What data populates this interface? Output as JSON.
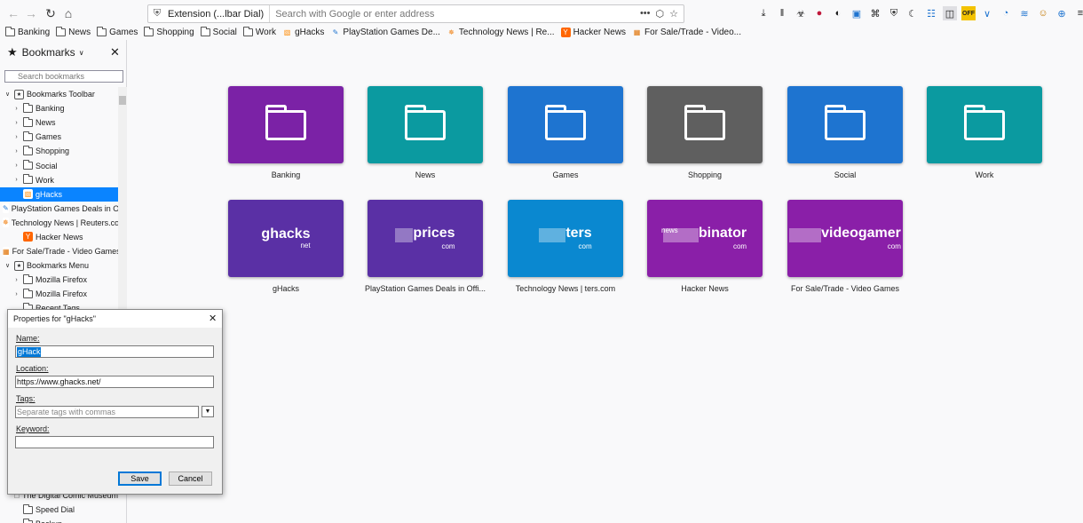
{
  "toolbar": {
    "url_identity": "Extension (...lbar Dial)",
    "url_placeholder": "Search with Google or enter address",
    "off_badge": "OFF"
  },
  "bookmarks_toolbar": [
    {
      "label": "Banking",
      "icon": "folder"
    },
    {
      "label": "News",
      "icon": "folder"
    },
    {
      "label": "Games",
      "icon": "folder"
    },
    {
      "label": "Shopping",
      "icon": "folder"
    },
    {
      "label": "Social",
      "icon": "folder"
    },
    {
      "label": "Work",
      "icon": "folder"
    },
    {
      "label": "gHacks",
      "icon": "ghacks-favicon"
    },
    {
      "label": "PlayStation Games De...",
      "icon": "playstation-favicon"
    },
    {
      "label": "Technology News | Re...",
      "icon": "reuters-favicon"
    },
    {
      "label": "Hacker News",
      "icon": "ycombinator-favicon"
    },
    {
      "label": "For Sale/Trade - Video...",
      "icon": "videogamer-favicon"
    }
  ],
  "sidebar": {
    "title": "Bookmarks",
    "search_placeholder": "Search bookmarks",
    "tree": [
      {
        "label": "Bookmarks Toolbar",
        "level": 0,
        "twisty": "open",
        "icon": "toolbar"
      },
      {
        "label": "Banking",
        "level": 1,
        "twisty": "closed",
        "icon": "folder"
      },
      {
        "label": "News",
        "level": 1,
        "twisty": "closed",
        "icon": "folder"
      },
      {
        "label": "Games",
        "level": 1,
        "twisty": "closed",
        "icon": "folder"
      },
      {
        "label": "Shopping",
        "level": 1,
        "twisty": "closed",
        "icon": "folder"
      },
      {
        "label": "Social",
        "level": 1,
        "twisty": "closed",
        "icon": "folder"
      },
      {
        "label": "Work",
        "level": 1,
        "twisty": "closed",
        "icon": "folder"
      },
      {
        "label": "gHacks",
        "level": 1,
        "twisty": "none",
        "icon": "ghacks",
        "selected": true
      },
      {
        "label": "PlayStation Games Deals in Offi...",
        "level": 1,
        "twisty": "none",
        "icon": "playstation"
      },
      {
        "label": "Technology News | Reuters.com",
        "level": 1,
        "twisty": "none",
        "icon": "reuters"
      },
      {
        "label": "Hacker News",
        "level": 1,
        "twisty": "none",
        "icon": "ycombinator"
      },
      {
        "label": "For Sale/Trade - Video Games",
        "level": 1,
        "twisty": "none",
        "icon": "videogamer"
      },
      {
        "label": "Bookmarks Menu",
        "level": 0,
        "twisty": "open",
        "icon": "menu"
      },
      {
        "label": "Mozilla Firefox",
        "level": 1,
        "twisty": "closed",
        "icon": "folder"
      },
      {
        "label": "Mozilla Firefox",
        "level": 1,
        "twisty": "closed",
        "icon": "folder"
      },
      {
        "label": "Recent Tags",
        "level": 1,
        "twisty": "none",
        "icon": "folder"
      }
    ],
    "tree_bottom": [
      {
        "label": "The Digital Comic Museum",
        "icon": "page"
      },
      {
        "label": "Speed Dial",
        "icon": "folder"
      },
      {
        "label": "Backup",
        "icon": "folder"
      }
    ]
  },
  "speed_dial": {
    "row1": [
      {
        "label": "Banking",
        "color": "#7b22a6"
      },
      {
        "label": "News",
        "color": "#0b9aa0"
      },
      {
        "label": "Games",
        "color": "#1e74d0"
      },
      {
        "label": "Shopping",
        "color": "#5f5f5f"
      },
      {
        "label": "Social",
        "color": "#1e74d0"
      },
      {
        "label": "Work",
        "color": "#0b9aa0"
      }
    ],
    "row2": [
      {
        "label": "gHacks",
        "color": "#5a30a5",
        "logo_main": "ghacks",
        "logo_sub": "net"
      },
      {
        "label": "PlayStation Games Deals in Offi...",
        "color": "#5a30a5",
        "logo_main": "prices",
        "logo_sub": "com"
      },
      {
        "label": "Technology News | ters.com",
        "color": "#0a88d0",
        "logo_main": "ters",
        "logo_sub": "com"
      },
      {
        "label": "Hacker News",
        "color": "#8a1fa8",
        "logo_top": "news",
        "logo_main": "binator",
        "logo_sub": "com"
      },
      {
        "label": "For Sale/Trade - Video Games",
        "color": "#8a1fa8",
        "logo_main": "videogamer",
        "logo_sub": "com"
      }
    ]
  },
  "dialog": {
    "title": "Properties for \"gHacks\"",
    "name_label": "Name:",
    "name_value": "gHacks",
    "location_label": "Location:",
    "location_value": "https://www.ghacks.net/",
    "tags_label": "Tags:",
    "tags_placeholder": "Separate tags with commas",
    "keyword_label": "Keyword:",
    "keyword_value": "",
    "save_label": "Save",
    "cancel_label": "Cancel"
  }
}
